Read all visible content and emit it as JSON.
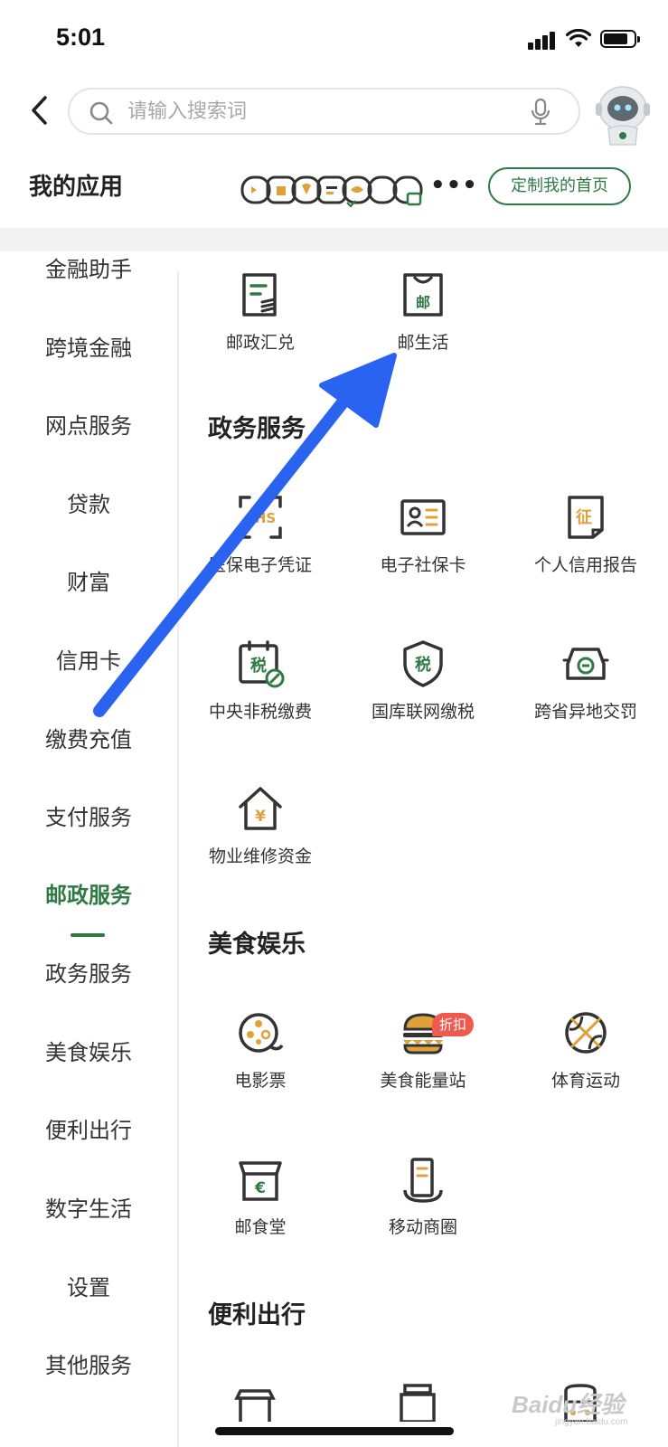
{
  "status_bar": {
    "time": "5:01"
  },
  "search": {
    "placeholder": "请输入搜索词"
  },
  "my_apps": {
    "title": "我的应用",
    "more": "•••",
    "customize_label": "定制我的首页"
  },
  "sidebar": {
    "items": [
      {
        "label": "金融助手"
      },
      {
        "label": "跨境金融"
      },
      {
        "label": "网点服务"
      },
      {
        "label": "贷款"
      },
      {
        "label": "财富"
      },
      {
        "label": "信用卡"
      },
      {
        "label": "缴费充值"
      },
      {
        "label": "支付服务"
      },
      {
        "label": "邮政服务",
        "active": true
      },
      {
        "label": "政务服务"
      },
      {
        "label": "美食娱乐"
      },
      {
        "label": "便利出行"
      },
      {
        "label": "数字生活"
      },
      {
        "label": "设置"
      },
      {
        "label": "其他服务"
      }
    ]
  },
  "postal_services": {
    "items": [
      {
        "label": "邮政汇兑",
        "icon": "remittance-icon"
      },
      {
        "label": "邮生活",
        "icon": "post-life-icon"
      }
    ]
  },
  "government": {
    "title": "政务服务",
    "items": [
      {
        "label": "医保电子凭证",
        "icon": "medical-insurance-icon"
      },
      {
        "label": "电子社保卡",
        "icon": "social-security-card-icon"
      },
      {
        "label": "个人信用报告",
        "icon": "credit-report-icon"
      },
      {
        "label": "中央非税缴费",
        "icon": "non-tax-payment-icon"
      },
      {
        "label": "国库联网缴税",
        "icon": "tax-shield-icon"
      },
      {
        "label": "跨省异地交罚",
        "icon": "traffic-fine-icon"
      },
      {
        "label": "物业维修资金",
        "icon": "property-fund-icon"
      }
    ]
  },
  "food_entertainment": {
    "title": "美食娱乐",
    "items": [
      {
        "label": "电影票",
        "icon": "film-reel-icon"
      },
      {
        "label": "美食能量站",
        "icon": "burger-icon",
        "badge": "折扣"
      },
      {
        "label": "体育运动",
        "icon": "basketball-icon"
      },
      {
        "label": "邮食堂",
        "icon": "canteen-store-icon"
      },
      {
        "label": "移动商圈",
        "icon": "mobile-mall-icon"
      }
    ]
  },
  "travel": {
    "title": "便利出行"
  },
  "watermark": {
    "main": "Baidu经验",
    "sub": "jingyan.baidu.com"
  },
  "colors": {
    "brand_green": "#2f7a44",
    "accent_orange": "#e0a03a",
    "badge_red": "#ef5a4f",
    "arrow_blue": "#2a63f0"
  }
}
